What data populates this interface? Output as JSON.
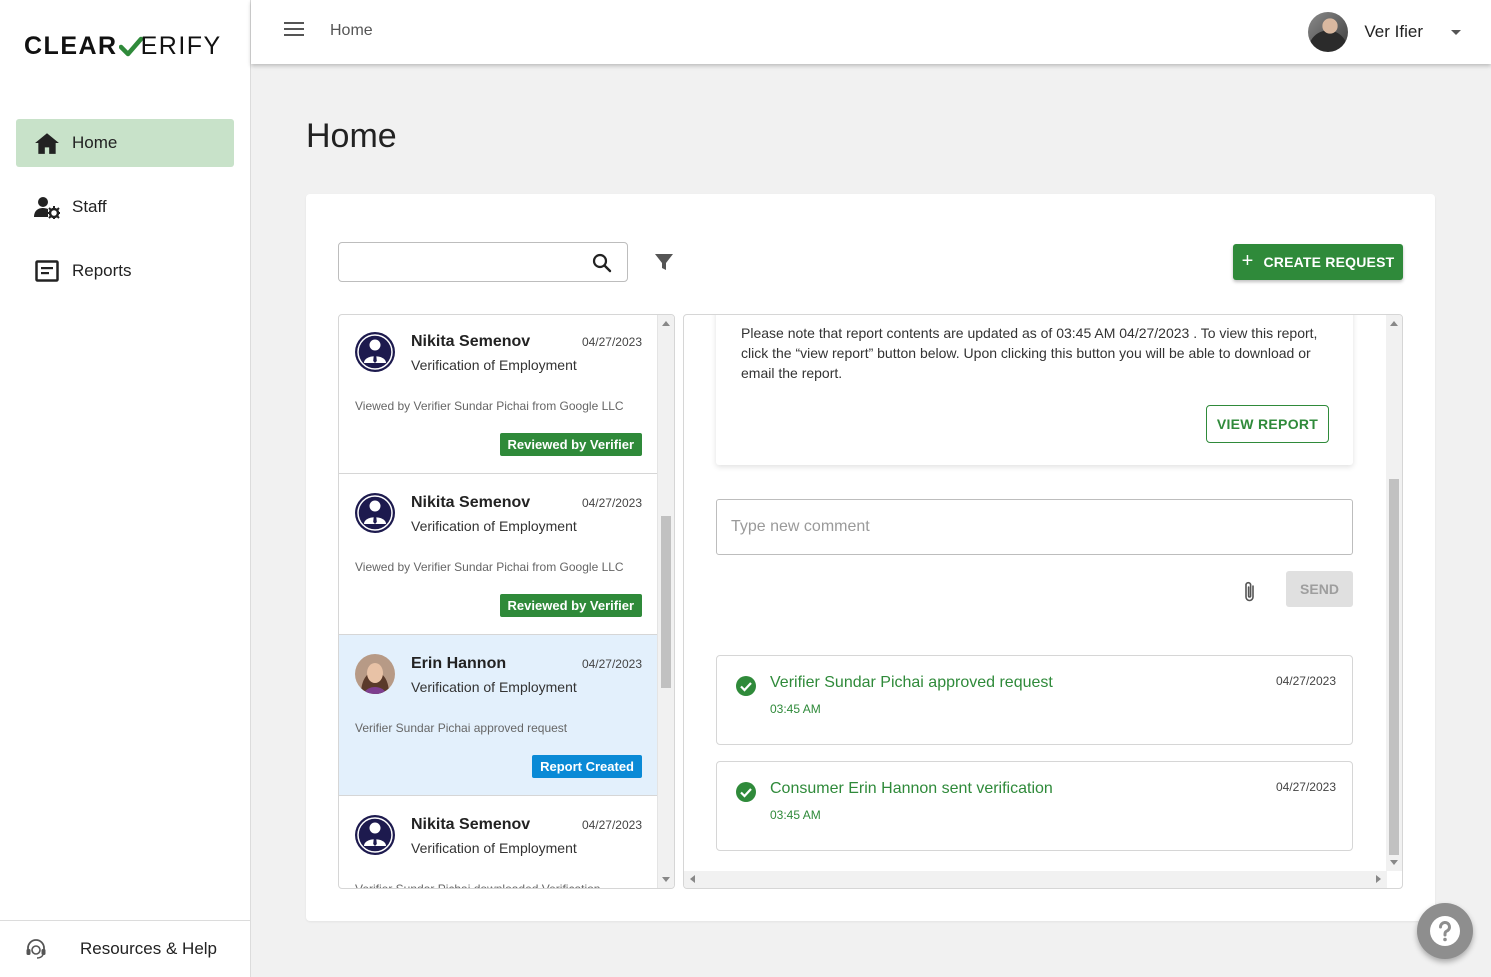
{
  "brand": {
    "logo_part1": "CLEAR",
    "logo_part2": "ERIFY"
  },
  "sidebar": {
    "items": [
      {
        "label": "Home",
        "icon": "home-icon",
        "active": true
      },
      {
        "label": "Staff",
        "icon": "staff-settings-icon",
        "active": false
      },
      {
        "label": "Reports",
        "icon": "reports-icon",
        "active": false
      }
    ],
    "footer_label": "Resources & Help"
  },
  "topbar": {
    "breadcrumb": "Home",
    "user_name": "Ver Ifier"
  },
  "page": {
    "title": "Home"
  },
  "toolbar": {
    "search_placeholder": "",
    "create_label": "CREATE REQUEST"
  },
  "requests": [
    {
      "name": "Nikita Semenov",
      "date": "04/27/2023",
      "type": "Verification of Employment",
      "note": "Viewed by Verifier Sundar Pichai from Google LLC",
      "badge": "Reviewed by Verifier",
      "badge_color": "#2f8a3a",
      "avatar": "generic-user-icon",
      "selected": false
    },
    {
      "name": "Nikita Semenov",
      "date": "04/27/2023",
      "type": "Verification of Employment",
      "note": "Viewed by Verifier Sundar Pichai from Google LLC",
      "badge": "Reviewed by Verifier",
      "badge_color": "#2f8a3a",
      "avatar": "generic-user-icon",
      "selected": false
    },
    {
      "name": "Erin Hannon",
      "date": "04/27/2023",
      "type": "Verification of Employment",
      "note": "Verifier Sundar Pichai approved request",
      "badge": "Report Created",
      "badge_color": "#0a8ad6",
      "avatar": "photo-avatar",
      "selected": true
    },
    {
      "name": "Nikita Semenov",
      "date": "04/27/2023",
      "type": "Verification of Employment",
      "note": "Verifier Sundar Pichai downloaded Verification",
      "badge": "",
      "badge_color": "",
      "avatar": "generic-user-icon",
      "selected": false
    }
  ],
  "list_scroll": {
    "position": 0.5
  },
  "detail": {
    "notice": "Please note that report contents are updated as of 03:45 AM 04/27/2023 . To view this report, click the “view report” button below. Upon clicking this button you will be able to download or email the report.",
    "view_report_label": "VIEW REPORT",
    "comment_placeholder": "Type new comment",
    "send_label": "SEND",
    "events": [
      {
        "title": "Verifier Sundar Pichai approved request",
        "time": "03:45 AM",
        "date": "04/27/2023"
      },
      {
        "title": "Consumer Erin Hannon sent verification",
        "time": "03:45 AM",
        "date": "04/27/2023"
      }
    ]
  },
  "colors": {
    "accent": "#2f8a3a",
    "active_nav": "#c8e2c9",
    "selected_row": "#e3f0fc",
    "info_badge": "#0a8ad6"
  }
}
